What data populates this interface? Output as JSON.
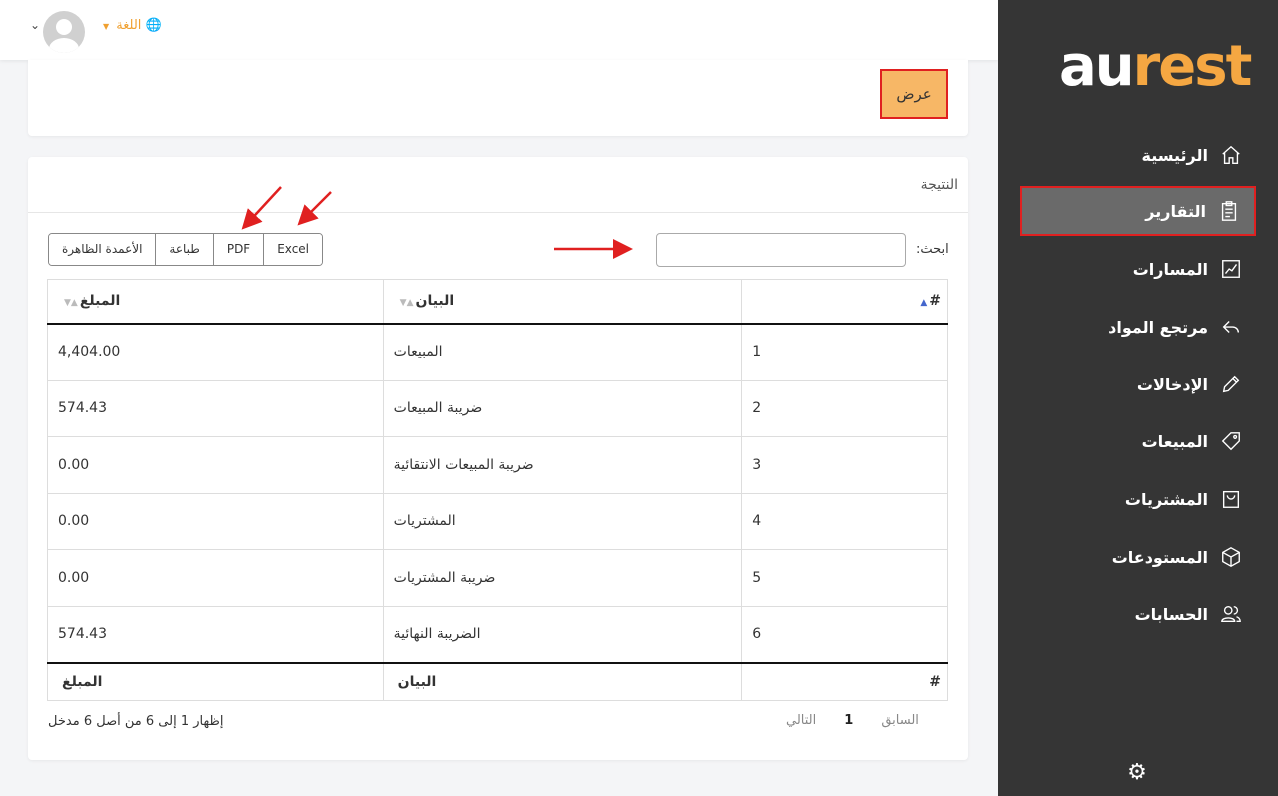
{
  "brand": {
    "part1": "au",
    "part2": "rest"
  },
  "topbar": {
    "language_label": "اللغة"
  },
  "sidebar": {
    "items": [
      {
        "label": "الرئيسية",
        "icon": "home-icon"
      },
      {
        "label": "التقارير",
        "icon": "clipboard-icon",
        "active": true
      },
      {
        "label": "المسارات",
        "icon": "chart-line-icon"
      },
      {
        "label": "مرتجع المواد",
        "icon": "reply-icon"
      },
      {
        "label": "الإدخالات",
        "icon": "pencil-icon"
      },
      {
        "label": "المبيعات",
        "icon": "tag-icon"
      },
      {
        "label": "المشتريات",
        "icon": "bag-icon"
      },
      {
        "label": "المستودعات",
        "icon": "box-icon"
      },
      {
        "label": "الحسابات",
        "icon": "users-icon"
      }
    ]
  },
  "filter": {
    "show_button": "عرض"
  },
  "result": {
    "title": "النتيجة",
    "search_label": "ابحث:",
    "export_buttons": [
      "Excel",
      "PDF",
      "طباعة",
      "الأعمدة الظاهرة"
    ],
    "columns": [
      "#",
      "البيان",
      "المبلغ"
    ],
    "rows": [
      {
        "num": "1",
        "desc": "المبيعات",
        "amount": "4,404.00"
      },
      {
        "num": "2",
        "desc": "ضريبة المبيعات",
        "amount": "574.43"
      },
      {
        "num": "3",
        "desc": "ضريبة المبيعات الانتقائية",
        "amount": "0.00"
      },
      {
        "num": "4",
        "desc": "المشتريات",
        "amount": "0.00"
      },
      {
        "num": "5",
        "desc": "ضريبة المشتريات",
        "amount": "0.00"
      },
      {
        "num": "6",
        "desc": "الضريبة النهائية",
        "amount": "574.43"
      }
    ],
    "pagination": {
      "prev": "السابق",
      "page": "1",
      "next": "التالي"
    },
    "info": "إظهار 1 إلى 6 من أصل 6 مدخل"
  },
  "colors": {
    "sidebar_bg": "#353535",
    "accent": "#f5a742",
    "highlight_border": "#e02020"
  }
}
